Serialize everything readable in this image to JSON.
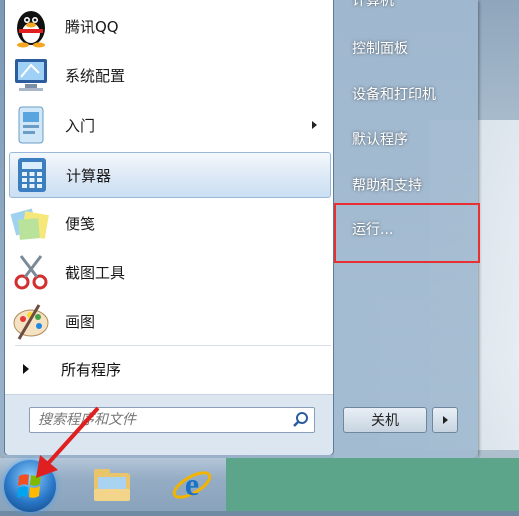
{
  "programs": [
    {
      "label": "腾讯QQ",
      "icon": "qq-penguin-icon"
    },
    {
      "label": "系统配置",
      "icon": "system-config-icon"
    },
    {
      "label": "入门",
      "icon": "getting-started-icon",
      "has_submenu": true
    },
    {
      "label": "计算器",
      "icon": "calculator-icon",
      "selected": true
    },
    {
      "label": "便笺",
      "icon": "sticky-notes-icon"
    },
    {
      "label": "截图工具",
      "icon": "snipping-tool-icon"
    },
    {
      "label": "画图",
      "icon": "paint-icon"
    }
  ],
  "all_programs_label": "所有程序",
  "search": {
    "placeholder": "搜索程序和文件"
  },
  "right_menu": {
    "top_partial": "计算机",
    "items": [
      "控制面板",
      "设备和打印机",
      "默认程序",
      "帮助和支持",
      "运行..."
    ]
  },
  "shutdown_label": "关机",
  "colors": {
    "highlight_box": "#e83030",
    "pointer_arrow": "#e02020",
    "taskbar_green": "#5da58a"
  }
}
